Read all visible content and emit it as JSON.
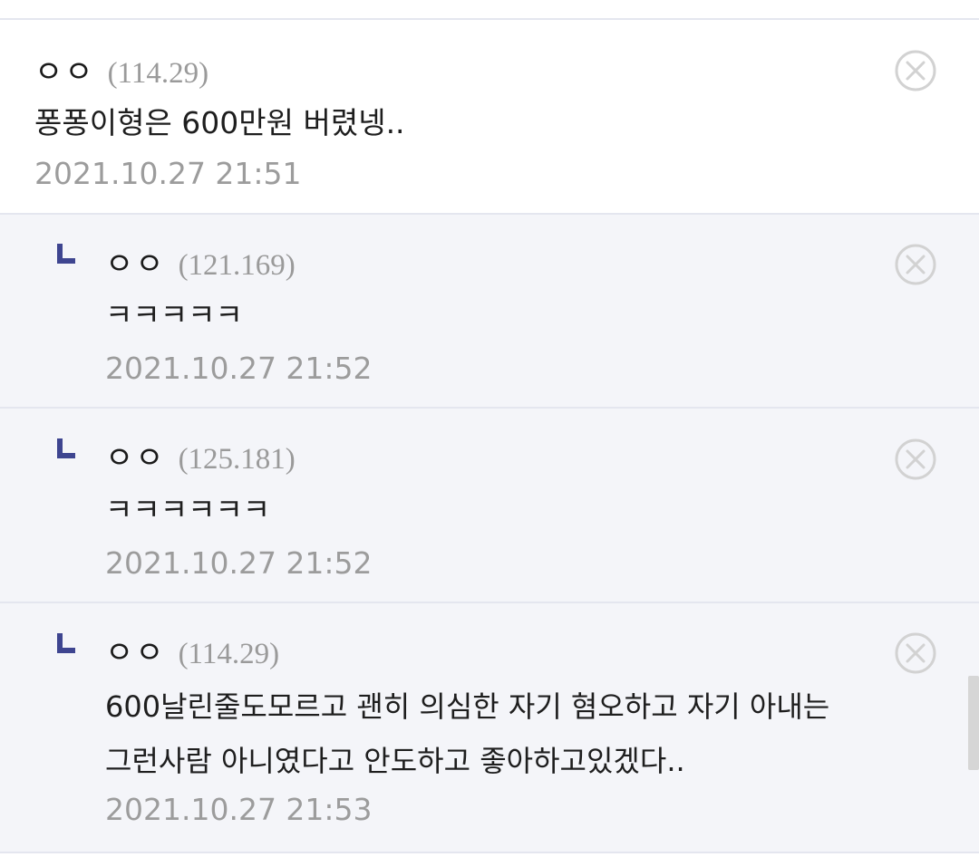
{
  "comments": [
    {
      "type": "root",
      "author": "ㅇㅇ",
      "ip": "(114.29)",
      "lines": [
        "퐁퐁이형은 600만원 버렸넹.."
      ],
      "date": "2021.10.27 21:51"
    },
    {
      "type": "reply",
      "author": "ㅇㅇ",
      "ip": "(121.169)",
      "lines": [
        "ㅋㅋㅋㅋㅋ"
      ],
      "date": "2021.10.27 21:52"
    },
    {
      "type": "reply",
      "author": "ㅇㅇ",
      "ip": "(125.181)",
      "lines": [
        "ㅋㅋㅋㅋㅋㅋ"
      ],
      "date": "2021.10.27 21:52"
    },
    {
      "type": "reply",
      "author": "ㅇㅇ",
      "ip": "(114.29)",
      "lines": [
        "600날린줄도모르고 괜히 의심한 자기 혐오하고 자기 아내는",
        "그런사람 아니였다고 안도하고 좋아하고있겠다.."
      ],
      "date": "2021.10.27 21:53"
    }
  ],
  "icons": {
    "delete": "close-circle-icon",
    "reply_marker": "reply-arrow-icon"
  },
  "colors": {
    "reply_background": "#f4f5f9",
    "reply_marker": "#3e4590",
    "divider": "#e4e6ef",
    "muted_text": "#9c9c9c"
  }
}
